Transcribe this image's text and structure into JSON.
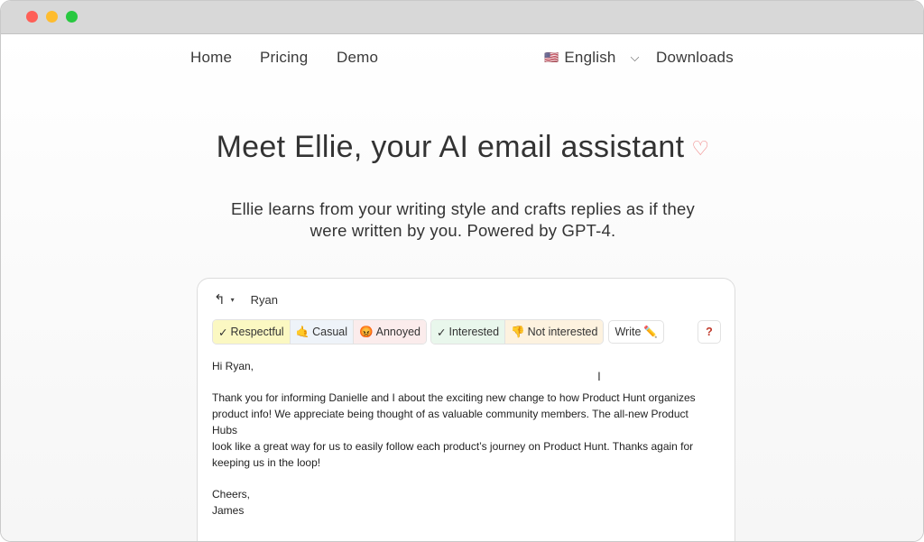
{
  "nav": {
    "home": "Home",
    "pricing": "Pricing",
    "demo": "Demo",
    "language_flag": "🇺🇸",
    "language": "English",
    "language_chevron": "⌵",
    "downloads": "Downloads"
  },
  "hero": {
    "title": "Meet Ellie, your AI email assistant",
    "heart": "♡",
    "subtitle_line1": "Ellie learns from your writing style and crafts replies as if they",
    "subtitle_line2": "were written by you. Powered by GPT-4."
  },
  "composer": {
    "reply_icon": "↰",
    "reply_caret": "▾",
    "recipient": "Ryan",
    "tones": [
      {
        "icon": "✓",
        "label": "Respectful"
      },
      {
        "icon": "🤙",
        "label": "Casual"
      },
      {
        "icon": "😡",
        "label": "Annoyed"
      }
    ],
    "intents": [
      {
        "icon": "✓",
        "label": "Interested"
      },
      {
        "icon": "👎",
        "label": "Not interested"
      }
    ],
    "write": {
      "label": "Write",
      "icon": "✏️"
    },
    "help": "?",
    "body": {
      "greeting": "Hi Ryan,",
      "paragraph_lines": [
        "Thank you for informing Danielle and I about the exciting new change to how Product Hunt organizes",
        "product info! We appreciate being thought of as valuable community members. The all-new Product Hubs",
        "look like a great way for us to easily follow each product’s journey on Product Hunt. Thanks again for",
        "keeping us in the loop!"
      ],
      "signoff": "Cheers,",
      "name": "James"
    },
    "cursor": "I"
  }
}
